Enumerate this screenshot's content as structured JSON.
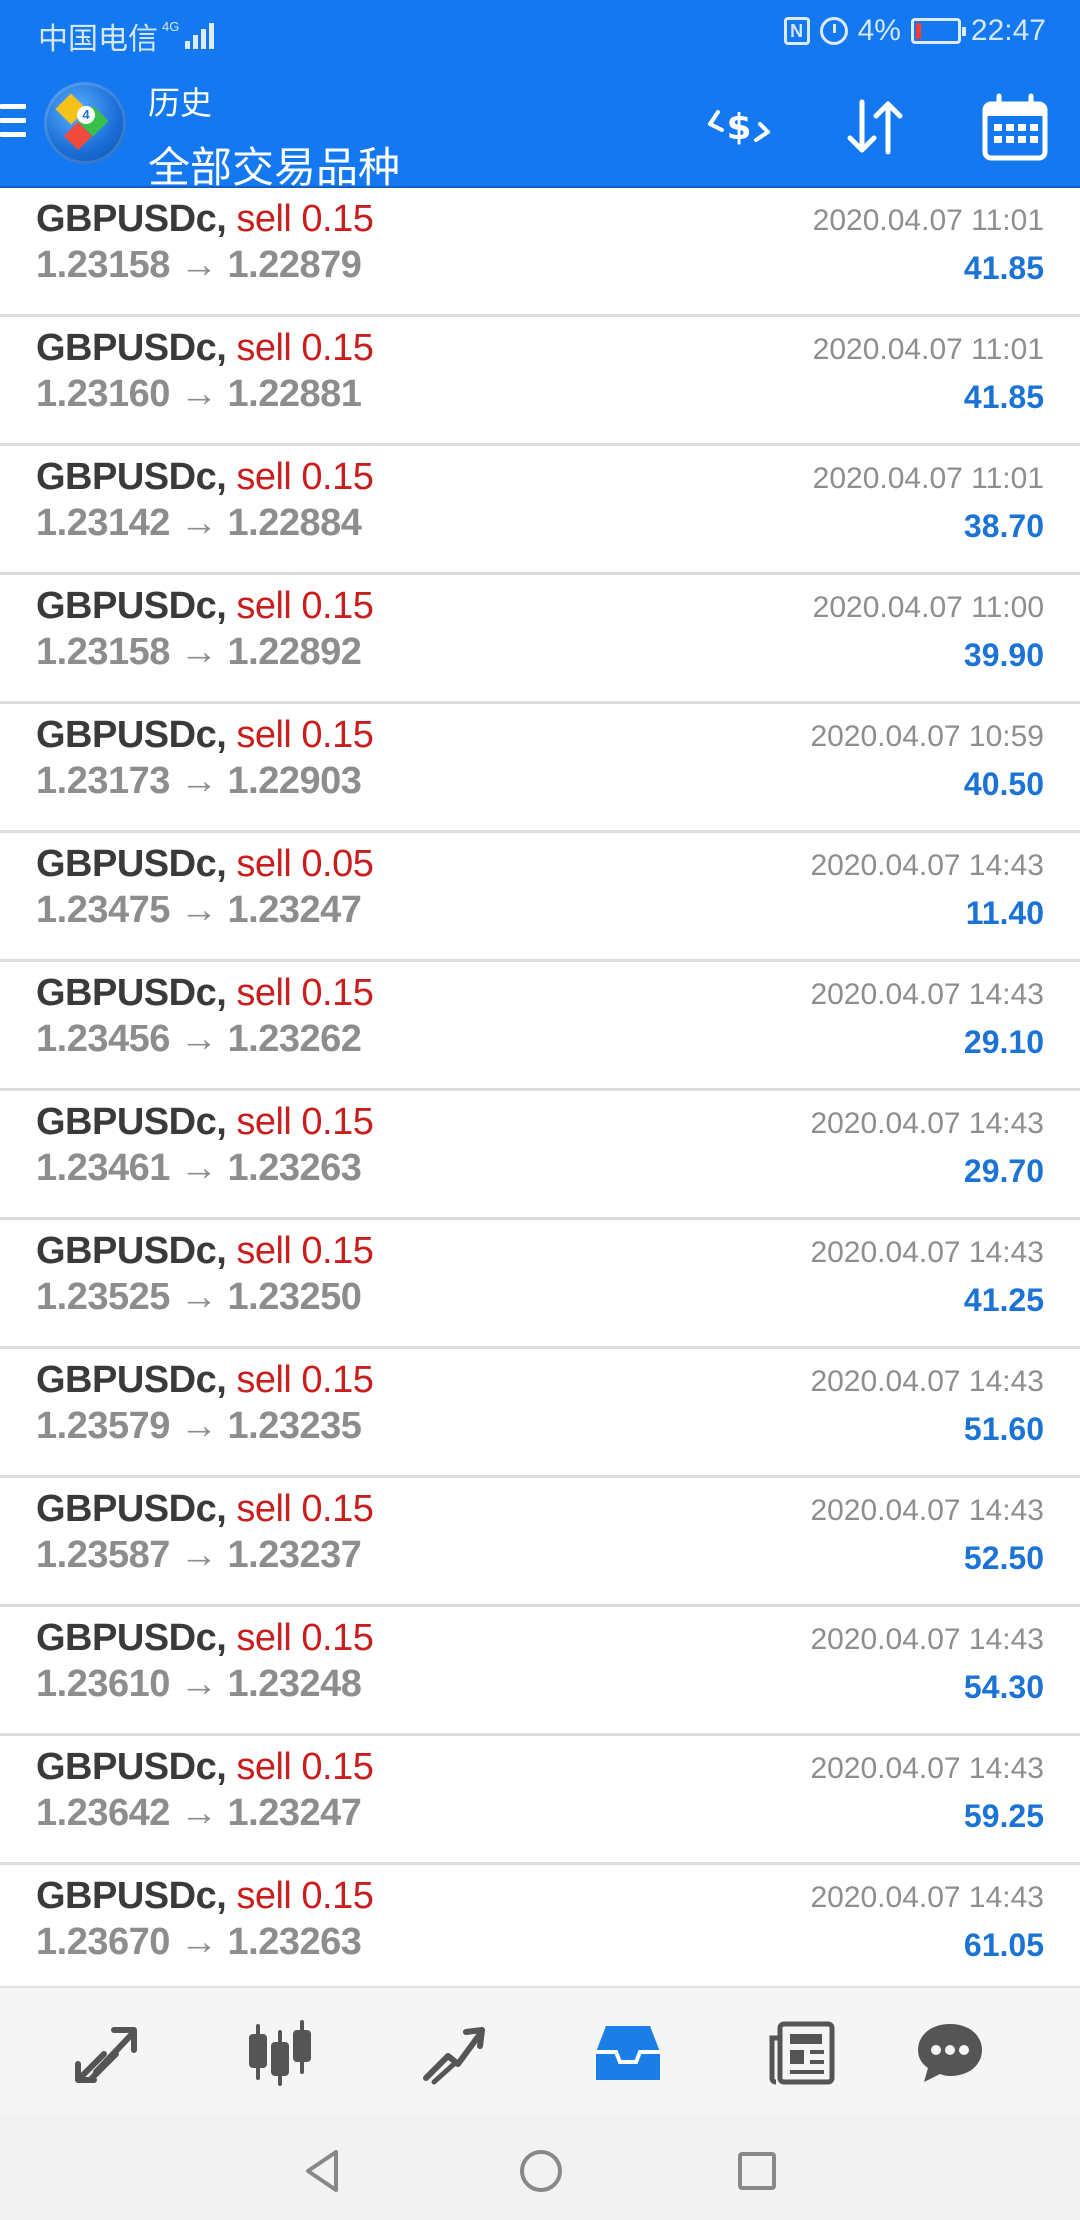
{
  "status_bar": {
    "carrier": "中国电信",
    "network": "4G",
    "battery_percent": "4%",
    "time": "22:47",
    "icons": [
      "nfc-icon",
      "alarm-icon",
      "battery-icon"
    ]
  },
  "toolbar": {
    "subtitle": "历史",
    "title": "全部交易品种",
    "icons": [
      "menu-icon",
      "metatrader-logo-icon",
      "currency-exchange-icon",
      "sort-icon",
      "calendar-icon"
    ]
  },
  "trades": [
    {
      "symbol": "GBPUSDc,",
      "side": "sell 0.15",
      "open": "1.23158",
      "close": "1.22879",
      "time": "2020.04.07 11:01",
      "profit": "41.85"
    },
    {
      "symbol": "GBPUSDc,",
      "side": "sell 0.15",
      "open": "1.23160",
      "close": "1.22881",
      "time": "2020.04.07 11:01",
      "profit": "41.85"
    },
    {
      "symbol": "GBPUSDc,",
      "side": "sell 0.15",
      "open": "1.23142",
      "close": "1.22884",
      "time": "2020.04.07 11:01",
      "profit": "38.70"
    },
    {
      "symbol": "GBPUSDc,",
      "side": "sell 0.15",
      "open": "1.23158",
      "close": "1.22892",
      "time": "2020.04.07 11:00",
      "profit": "39.90"
    },
    {
      "symbol": "GBPUSDc,",
      "side": "sell 0.15",
      "open": "1.23173",
      "close": "1.22903",
      "time": "2020.04.07 10:59",
      "profit": "40.50"
    },
    {
      "symbol": "GBPUSDc,",
      "side": "sell 0.05",
      "open": "1.23475",
      "close": "1.23247",
      "time": "2020.04.07 14:43",
      "profit": "11.40"
    },
    {
      "symbol": "GBPUSDc,",
      "side": "sell 0.15",
      "open": "1.23456",
      "close": "1.23262",
      "time": "2020.04.07 14:43",
      "profit": "29.10"
    },
    {
      "symbol": "GBPUSDc,",
      "side": "sell 0.15",
      "open": "1.23461",
      "close": "1.23263",
      "time": "2020.04.07 14:43",
      "profit": "29.70"
    },
    {
      "symbol": "GBPUSDc,",
      "side": "sell 0.15",
      "open": "1.23525",
      "close": "1.23250",
      "time": "2020.04.07 14:43",
      "profit": "41.25"
    },
    {
      "symbol": "GBPUSDc,",
      "side": "sell 0.15",
      "open": "1.23579",
      "close": "1.23235",
      "time": "2020.04.07 14:43",
      "profit": "51.60"
    },
    {
      "symbol": "GBPUSDc,",
      "side": "sell 0.15",
      "open": "1.23587",
      "close": "1.23237",
      "time": "2020.04.07 14:43",
      "profit": "52.50"
    },
    {
      "symbol": "GBPUSDc,",
      "side": "sell 0.15",
      "open": "1.23610",
      "close": "1.23248",
      "time": "2020.04.07 14:43",
      "profit": "54.30"
    },
    {
      "symbol": "GBPUSDc,",
      "side": "sell 0.15",
      "open": "1.23642",
      "close": "1.23247",
      "time": "2020.04.07 14:43",
      "profit": "59.25"
    },
    {
      "symbol": "GBPUSDc,",
      "side": "sell 0.15",
      "open": "1.23670",
      "close": "1.23263",
      "time": "2020.04.07 14:43",
      "profit": "61.05"
    }
  ],
  "bottom_nav": {
    "items": [
      "quotes-icon",
      "chart-icon",
      "trade-icon",
      "history-icon",
      "news-icon",
      "messages-icon"
    ],
    "active": "history-icon"
  },
  "system_nav": [
    "back-icon",
    "home-icon",
    "recents-icon"
  ],
  "colors": {
    "primary_blue": "#1479f0",
    "sell_red": "#c81e1e",
    "profit_blue": "#1b73d6",
    "nav_active": "#1a7ee6",
    "nav_inactive": "#555555"
  }
}
